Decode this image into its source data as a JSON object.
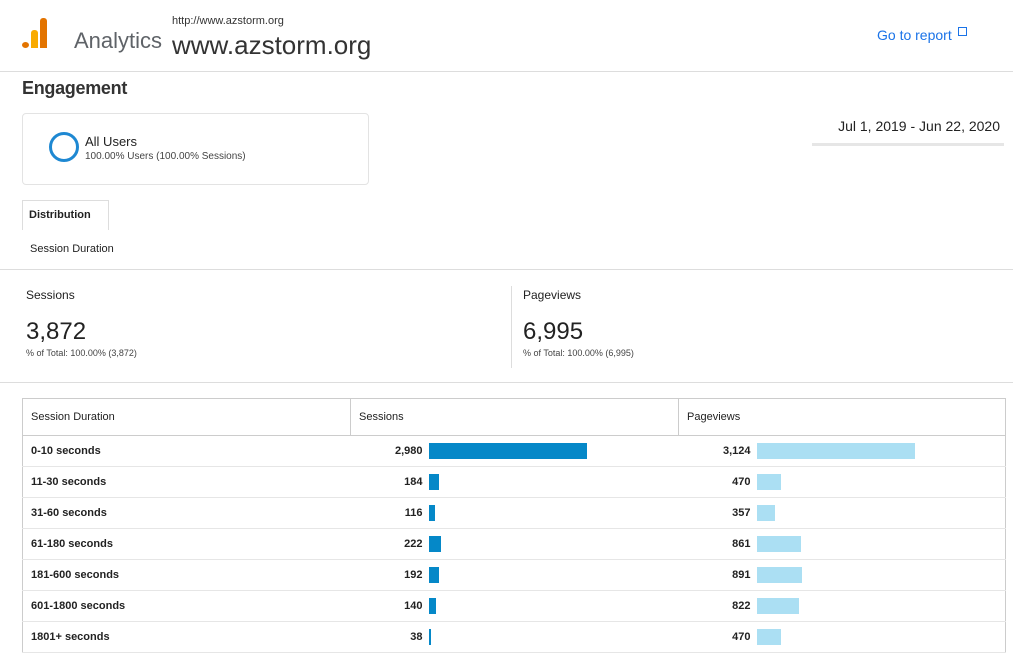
{
  "header": {
    "app_name": "Analytics",
    "site_url_small": "http://www.azstorm.org",
    "site_url_big": "www.azstorm.org",
    "goto_label": "Go to report"
  },
  "page_title": "Engagement",
  "segment": {
    "name": "All Users",
    "subtitle": "100.00% Users (100.00% Sessions)"
  },
  "date_range": "Jul 1, 2019 - Jun 22, 2020",
  "tab": "Distribution",
  "dimension_label": "Session Duration",
  "metrics": {
    "sessions": {
      "label": "Sessions",
      "value": "3,872",
      "total": "% of Total: 100.00% (3,872)"
    },
    "pageviews": {
      "label": "Pageviews",
      "value": "6,995",
      "total": "% of Total: 100.00% (6,995)"
    }
  },
  "table": {
    "headers": [
      "Session Duration",
      "Sessions",
      "Pageviews"
    ],
    "rows": [
      {
        "duration": "0-10 seconds",
        "sessions": "2,980",
        "pageviews": "3,124"
      },
      {
        "duration": "11-30 seconds",
        "sessions": "184",
        "pageviews": "470"
      },
      {
        "duration": "31-60 seconds",
        "sessions": "116",
        "pageviews": "357"
      },
      {
        "duration": "61-180 seconds",
        "sessions": "222",
        "pageviews": "861"
      },
      {
        "duration": "181-600 seconds",
        "sessions": "192",
        "pageviews": "891"
      },
      {
        "duration": "601-1800 seconds",
        "sessions": "140",
        "pageviews": "822"
      },
      {
        "duration": "1801+ seconds",
        "sessions": "38",
        "pageviews": "470"
      }
    ]
  },
  "colors": {
    "sessions_bar": "#0588c8",
    "pageviews_bar": "#abdff3",
    "link": "#1a73e8",
    "segment_circle": "#1e88d2"
  },
  "icons": {
    "logo": "analytics-logo-icon",
    "external": "external-link-icon",
    "segment": "segment-circle-icon"
  }
}
